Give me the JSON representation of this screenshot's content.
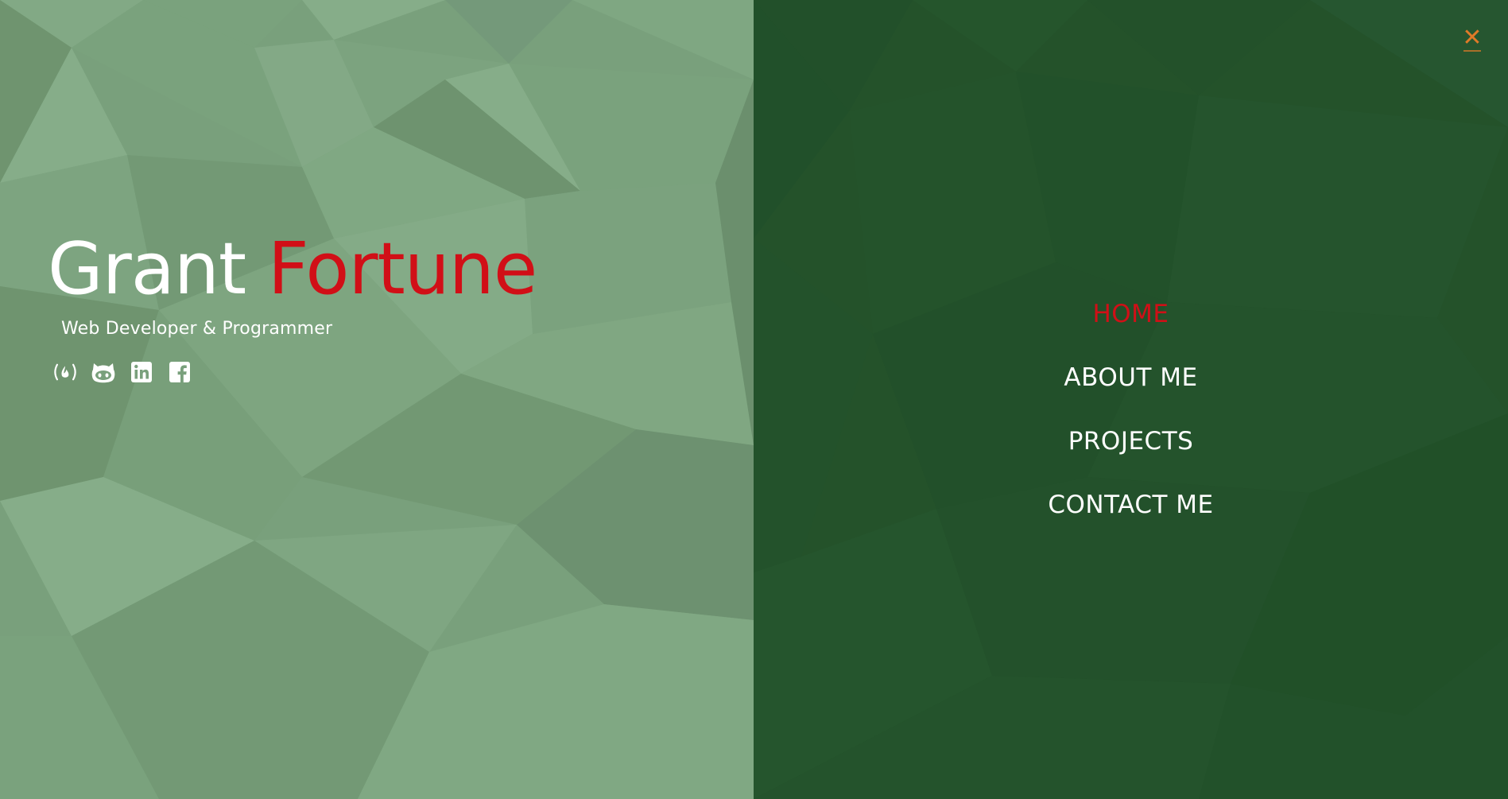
{
  "hero": {
    "first_name": "Grant",
    "last_name": "Fortune",
    "subtitle": "Web Developer & Programmer",
    "social": [
      {
        "icon": "freecodecamp-icon"
      },
      {
        "icon": "github-icon"
      },
      {
        "icon": "linkedin-icon"
      },
      {
        "icon": "facebook-icon"
      }
    ]
  },
  "menu": {
    "close_label": "✕",
    "items": [
      {
        "label": "HOME",
        "active": true
      },
      {
        "label": "ABOUT ME",
        "active": false
      },
      {
        "label": "PROJECTS",
        "active": false
      },
      {
        "label": "CONTACT ME",
        "active": false
      }
    ]
  },
  "colors": {
    "accent_red": "#d10f17",
    "close_orange": "#e07a28",
    "hero_green": "#79a07c",
    "menu_green": "#24522a"
  }
}
